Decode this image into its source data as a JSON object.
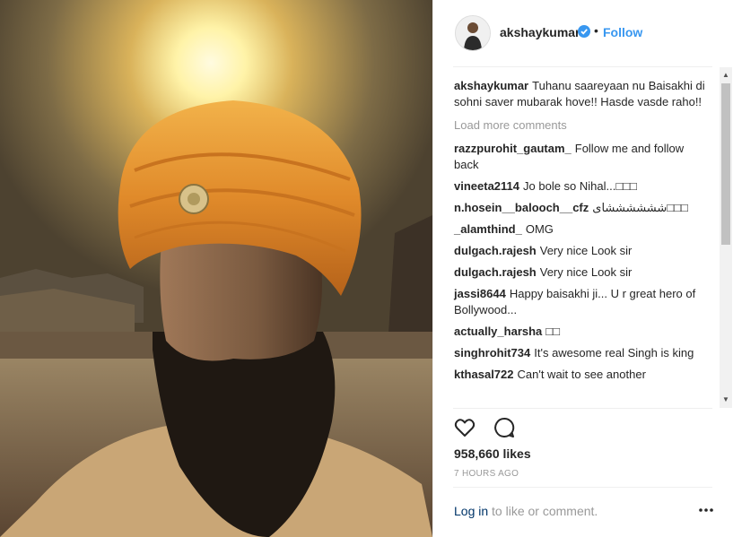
{
  "post": {
    "username": "akshaykumar",
    "follow_label": "Follow",
    "dot": "•",
    "caption_user": "akshaykumar",
    "caption_text": "Tuhanu saareyaan nu Baisakhi di sohni saver mubarak hove!! Hasde vasde raho!!",
    "load_more": "Load more comments",
    "likes": "958,660 likes",
    "time": "7 HOURS AGO",
    "login_link": "Log in",
    "login_rest": " to like or comment."
  },
  "comments": [
    {
      "user": "razzpurohit_gautam_",
      "text": "Follow me and follow back"
    },
    {
      "user": "vineeta2114",
      "text": "Jo bole so Nihal...□□□"
    },
    {
      "user": "n.hosein__balooch__cfz",
      "text": "ششششششای□□□"
    },
    {
      "user": "_alamthind_",
      "text": "OMG"
    },
    {
      "user": "dulgach.rajesh",
      "text": "Very nice Look sir"
    },
    {
      "user": "dulgach.rajesh",
      "text": "Very nice Look sir"
    },
    {
      "user": "jassi8644",
      "text": "Happy baisakhi ji... U r great hero of Bollywood..."
    },
    {
      "user": "actually_harsha",
      "text": "□□"
    },
    {
      "user": "singhrohit734",
      "text": "It's awesome real Singh is king"
    },
    {
      "user": "kthasal722",
      "text": "Can't wait to see another"
    }
  ],
  "icons": {
    "like": "heart-icon",
    "comment": "comment-icon",
    "verified": "verified-badge-icon",
    "more": "more-options-icon"
  },
  "colors": {
    "follow": "#3897f0",
    "login_link": "#003569",
    "muted": "#999999",
    "turban": "#e08a2a"
  }
}
